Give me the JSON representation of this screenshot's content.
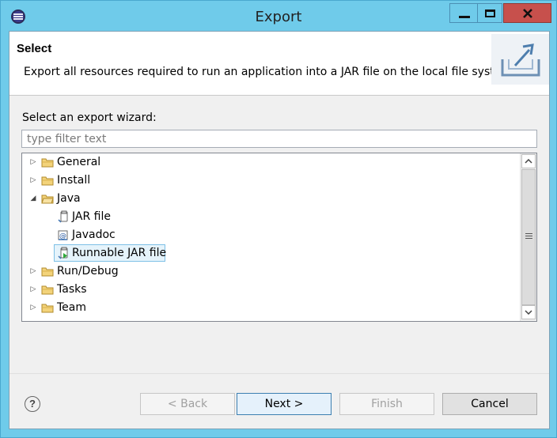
{
  "window": {
    "title": "Export"
  },
  "banner": {
    "title": "Select",
    "description": "Export all resources required to run an application into a JAR file on the local file system."
  },
  "wizard": {
    "label": "Select an export wizard:",
    "filter_placeholder": "type filter text",
    "filter_value": ""
  },
  "tree": [
    {
      "label": "General",
      "type": "folder",
      "expanded": false
    },
    {
      "label": "Install",
      "type": "folder",
      "expanded": false
    },
    {
      "label": "Java",
      "type": "folder",
      "expanded": true
    },
    {
      "label": "JAR file",
      "type": "jar",
      "icon": "jar-file-icon"
    },
    {
      "label": "Javadoc",
      "type": "javadoc",
      "icon": "javadoc-icon"
    },
    {
      "label": "Runnable JAR file",
      "type": "runnable-jar",
      "icon": "runnable-jar-icon",
      "selected": true
    },
    {
      "label": "Run/Debug",
      "type": "folder",
      "expanded": false
    },
    {
      "label": "Tasks",
      "type": "folder",
      "expanded": false
    },
    {
      "label": "Team",
      "type": "folder",
      "expanded": false
    }
  ],
  "buttons": {
    "back": "< Back",
    "next": "Next >",
    "finish": "Finish",
    "cancel": "Cancel",
    "help": "?"
  },
  "colors": {
    "titlebar": "#6fcbea",
    "close": "#c7504c",
    "selection": "#e5f3fb"
  }
}
